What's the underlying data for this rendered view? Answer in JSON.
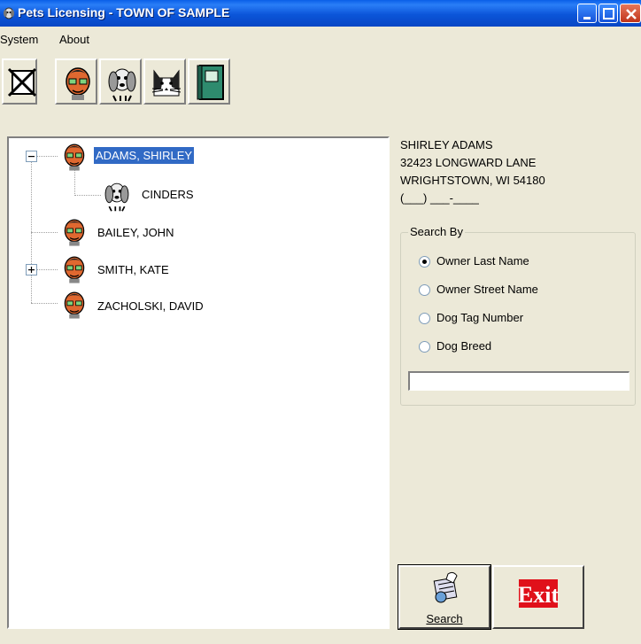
{
  "window": {
    "title": "Pets Licensing - TOWN OF SAMPLE"
  },
  "menu": {
    "items": [
      "System",
      "About"
    ]
  },
  "toolbar": {
    "buttons": [
      {
        "icon": "close-x-icon"
      },
      {
        "icon": "person-icon"
      },
      {
        "icon": "dog-icon"
      },
      {
        "icon": "cat-icon"
      },
      {
        "icon": "book-icon"
      }
    ]
  },
  "tree": {
    "nodes": [
      {
        "label": "ADAMS, SHIRLEY",
        "icon": "person-icon",
        "expander": "minus",
        "selected": true
      },
      {
        "label": "CINDERS",
        "icon": "dog-icon"
      },
      {
        "label": "BAILEY, JOHN",
        "icon": "person-icon"
      },
      {
        "label": "SMITH, KATE",
        "icon": "person-icon",
        "expander": "plus"
      },
      {
        "label": "ZACHOLSKI, DAVID",
        "icon": "person-icon"
      }
    ]
  },
  "owner": {
    "name": "SHIRLEY ADAMS",
    "street": "32423 LONGWARD LANE",
    "city": "WRIGHTSTOWN, WI 54180",
    "phone": "(___) ___-____"
  },
  "search_by": {
    "legend": "Search By",
    "options": [
      {
        "label": "Owner Last Name",
        "checked": true
      },
      {
        "label": "Owner Street Name",
        "checked": false
      },
      {
        "label": "Dog Tag Number",
        "checked": false
      },
      {
        "label": "Dog Breed",
        "checked": false
      }
    ],
    "input_value": ""
  },
  "actions": {
    "search_label": "Search",
    "exit_text": "Exit"
  },
  "colors": {
    "titlebar": "#0b55d9",
    "selection": "#316ac5",
    "exit_red": "#e0101a"
  }
}
